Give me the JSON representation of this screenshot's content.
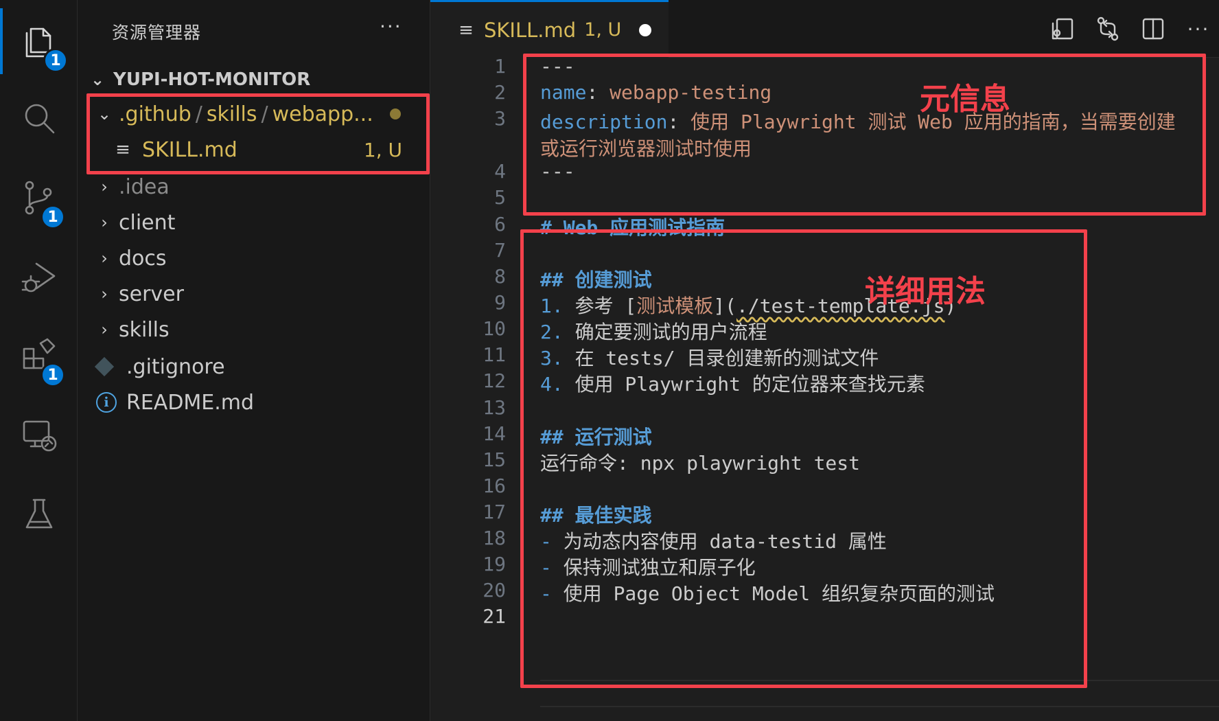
{
  "activity_bar": {
    "items": [
      {
        "name": "explorer",
        "icon": "files-icon",
        "badge": "1",
        "active": true
      },
      {
        "name": "search",
        "icon": "search-icon",
        "badge": null
      },
      {
        "name": "source-control",
        "icon": "source-control-icon",
        "badge": "1"
      },
      {
        "name": "run-debug",
        "icon": "run-debug-icon",
        "badge": null
      },
      {
        "name": "extensions",
        "icon": "extensions-icon",
        "badge": "1"
      },
      {
        "name": "remote-explorer",
        "icon": "remote-explorer-icon",
        "badge": null
      },
      {
        "name": "testing",
        "icon": "flask-icon",
        "badge": null
      }
    ]
  },
  "sidebar": {
    "title": "资源管理器",
    "more": "···",
    "root": "YUPI-HOT-MONITOR",
    "github_path": {
      "part1": ".github",
      "part2": "skills",
      "part3": "webapp..."
    },
    "skill_file": {
      "name": "SKILL.md",
      "status": "1, U"
    },
    "items": [
      {
        "label": ".idea"
      },
      {
        "label": "client"
      },
      {
        "label": "docs"
      },
      {
        "label": "server"
      },
      {
        "label": "skills"
      }
    ],
    "gitignore": ".gitignore",
    "readme": "README.md"
  },
  "tab": {
    "name": "SKILL.md",
    "status": "1, U"
  },
  "toolbar": {
    "more": "···"
  },
  "editor": {
    "line_numbers": [
      "1",
      "2",
      "3",
      "4",
      "5",
      "6",
      "7",
      "8",
      "9",
      "10",
      "11",
      "12",
      "13",
      "14",
      "15",
      "16",
      "17",
      "18",
      "19",
      "20",
      "21"
    ],
    "lines": {
      "l1": "---",
      "l2_key": "name",
      "l2_sep": ": ",
      "l2_val": "webapp-testing",
      "l3_key": "description",
      "l3_sep": ": ",
      "l3_val": "使用 Playwright 测试 Web 应用的指南，当需要创建",
      "l3_wrap": "或运行浏览器测试时使用",
      "l4": "---",
      "l6": "# Web 应用测试指南",
      "l8": "## 创建测试",
      "l9_num": "1.",
      "l9_pre": " 参考 [",
      "l9_link": "测试模板",
      "l9_mid": "](",
      "l9_url": "./test-template.js",
      "l9_end": ")",
      "l10_num": "2.",
      "l10_text": " 确定要测试的用户流程",
      "l11_num": "3.",
      "l11_text": " 在 tests/ 目录创建新的测试文件",
      "l12_num": "4.",
      "l12_text": " 使用 Playwright 的定位器来查找元素",
      "l14": "## 运行测试",
      "l15": "运行命令: npx playwright test",
      "l17": "## 最佳实践",
      "l18_dash": "-",
      "l18_text": " 为动态内容使用 data-testid 属性",
      "l19_dash": "-",
      "l19_text": " 保持测试独立和原子化",
      "l20_dash": "-",
      "l20_text": " 使用 Page Object Model 组织复杂页面的测试"
    }
  },
  "annotations": {
    "meta": "元信息",
    "usage": "详细用法"
  },
  "colors": {
    "accent": "#0078d4",
    "annotation_red": "#f3414b",
    "git_untracked": "#d7ba59",
    "yaml_key": "#569cd6",
    "yaml_value": "#ce9178"
  }
}
